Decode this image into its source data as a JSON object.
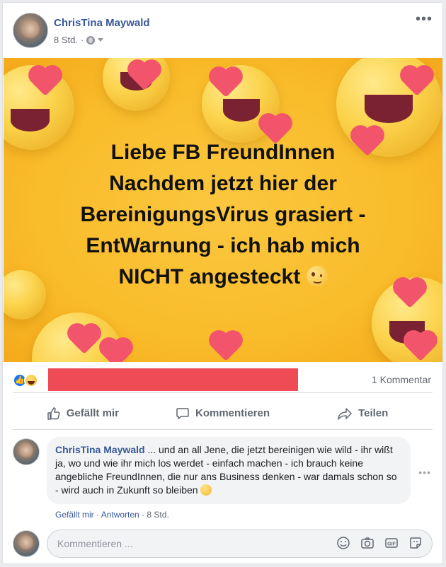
{
  "post": {
    "author": "ChrisTina Maywald",
    "time": "8 Std.",
    "separator": "·"
  },
  "banner": {
    "line1": "Liebe FB FreundInnen",
    "line2": "Nachdem jetzt hier der",
    "line3": "BereinigungsVirus grasiert -",
    "line4": "EntWarnung - ich hab mich",
    "line5": "NICHT angesteckt",
    "background": "#f9bc2a"
  },
  "reactions": {
    "comment_count": "1 Kommentar",
    "redaction_color": "#ef4b55"
  },
  "actions": {
    "like": "Gefällt mir",
    "comment": "Kommentieren",
    "share": "Teilen"
  },
  "comment": {
    "author": "ChrisTina Maywald",
    "text": " ... und an all Jene, die jetzt bereinigen wie wild - ihr wißt ja, wo und wie ihr mich los werdet - einfach machen - ich brauch keine angebliche FreundInnen, die nur ans Business denken - war damals schon so - wird auch in Zukunft so bleiben",
    "like": "Gefällt mir",
    "reply": "Antworten",
    "time": "8 Std."
  },
  "composer": {
    "placeholder": "Kommentieren ..."
  },
  "colors": {
    "link": "#385898",
    "accent": "#1877f2"
  }
}
